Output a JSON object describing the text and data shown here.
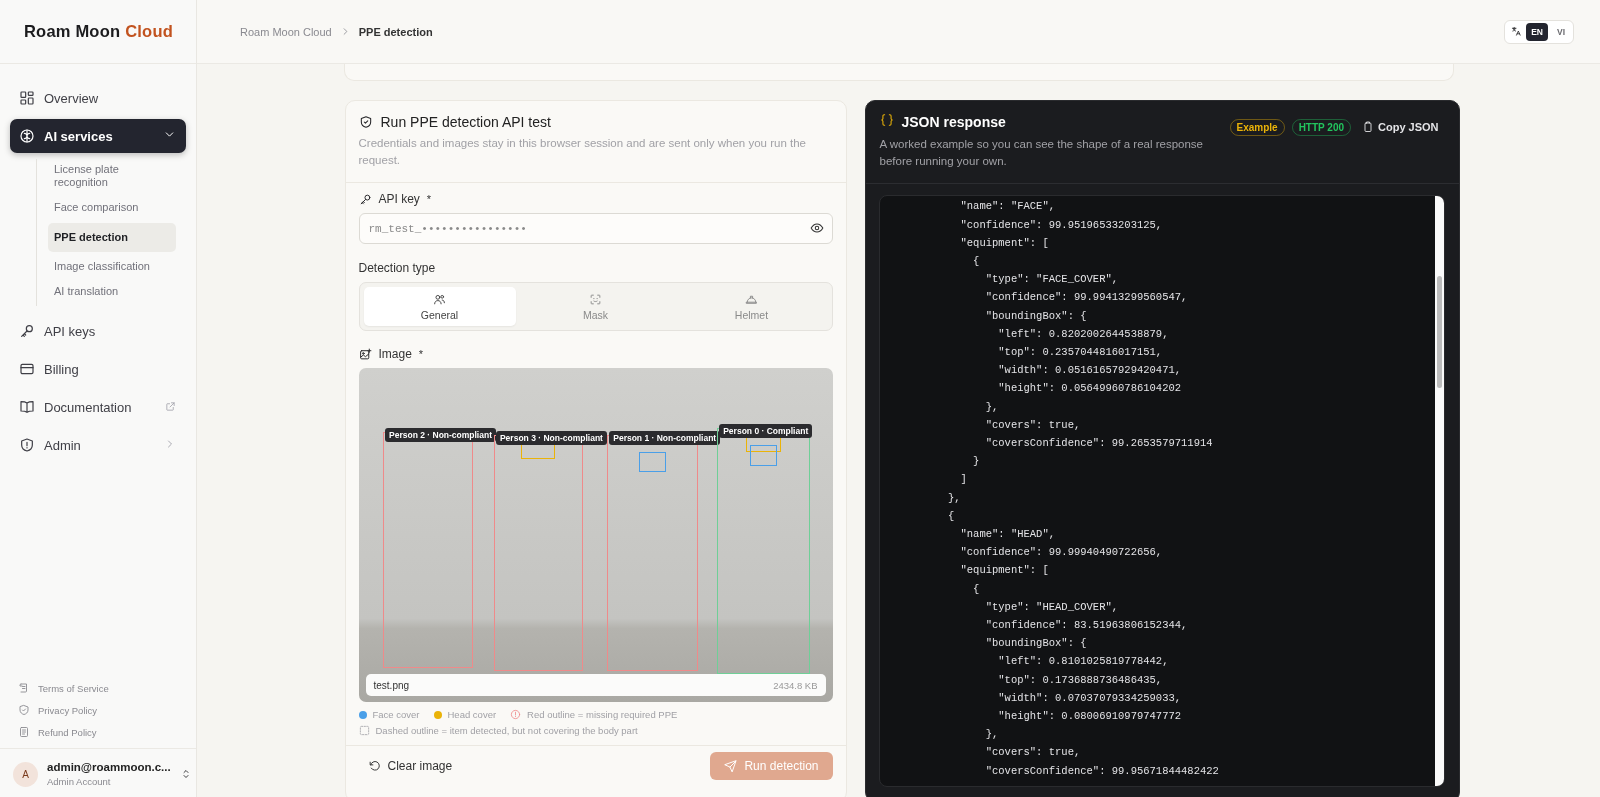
{
  "logo": {
    "text": "Roam Moon",
    "accent": "Cloud"
  },
  "breadcrumb": [
    "Roam Moon Cloud",
    "PPE detection"
  ],
  "languages": [
    {
      "label": "EN",
      "selected": true
    },
    {
      "label": "VI",
      "selected": false
    }
  ],
  "sidebar": {
    "items": [
      {
        "label": "Overview",
        "kind": "plain",
        "selected": false
      },
      {
        "label": "AI services",
        "kind": "group",
        "selected": true,
        "expanded": true,
        "children": [
          {
            "label": "License plate recognition",
            "selected": false
          },
          {
            "label": "Face comparison",
            "selected": false
          },
          {
            "label": "PPE detection",
            "selected": true
          },
          {
            "label": "Image classification",
            "selected": false
          },
          {
            "label": "AI translation",
            "selected": false
          }
        ]
      },
      {
        "label": "API keys",
        "kind": "plain",
        "selected": false
      },
      {
        "label": "Billing",
        "kind": "plain",
        "selected": false
      },
      {
        "label": "Documentation",
        "kind": "external",
        "selected": false
      },
      {
        "label": "Admin",
        "kind": "submenu",
        "selected": false
      }
    ],
    "footer_links": [
      "Terms of Service",
      "Privacy Policy",
      "Refund Policy"
    ],
    "user": {
      "avatar": "A",
      "email": "admin@roammoon.c...",
      "role": "Admin Account"
    }
  },
  "test_panel": {
    "title": "Run PPE detection API test",
    "description": "Credentials and images stay in this browser session and are sent only when you run the request.",
    "api_key": {
      "label": "API key",
      "required": "*",
      "value": "rm_test_••••••••••••••••"
    },
    "detection_type": {
      "label": "Detection type",
      "options": [
        {
          "label": "General",
          "selected": true
        },
        {
          "label": "Mask",
          "selected": false
        },
        {
          "label": "Helmet",
          "selected": false
        }
      ]
    },
    "image": {
      "label": "Image",
      "required": "*",
      "file_name": "test.png",
      "file_size": "2434.8 KB",
      "persons": [
        {
          "label": "Person 2 · Non-compliant",
          "compliant": false,
          "face_cover": false,
          "head_cover": false
        },
        {
          "label": "Person 3 · Non-compliant",
          "compliant": false,
          "face_cover": false,
          "head_cover": true
        },
        {
          "label": "Person 1 · Non-compliant",
          "compliant": false,
          "face_cover": true,
          "head_cover": false
        },
        {
          "label": "Person 0 · Compliant",
          "compliant": true,
          "face_cover": true,
          "head_cover": true
        }
      ]
    },
    "legend": [
      {
        "kind": "dot",
        "label": "Face cover",
        "color": "#4a9fe8"
      },
      {
        "kind": "dot",
        "label": "Head cover",
        "color": "#eab308"
      },
      {
        "kind": "outline",
        "label": "Red outline = missing required PPE"
      },
      {
        "kind": "dashed",
        "label": "Dashed outline = item detected, but not covering the body part"
      }
    ],
    "actions": [
      "Clear image",
      "Run detection"
    ]
  },
  "response_panel": {
    "title": "JSON response",
    "description": "A worked example so you can see the shape of a real response before running your own.",
    "badges": [
      {
        "label": "Example",
        "color": "#eab308"
      },
      {
        "label": "HTTP 200",
        "color": "#22c55e"
      }
    ],
    "copy_button": "Copy JSON",
    "code_lines": [
      "          \"name\": \"FACE\",",
      "          \"confidence\": 99.95196533203125,",
      "          \"equipment\": [",
      "            {",
      "              \"type\": \"FACE_COVER\",",
      "              \"confidence\": 99.99413299560547,",
      "              \"boundingBox\": {",
      "                \"left\": 0.8202002644538879,",
      "                \"top\": 0.2357044816017151,",
      "                \"width\": 0.05161657929420471,",
      "                \"height\": 0.05649960786104202",
      "              },",
      "              \"covers\": true,",
      "              \"coversConfidence\": 99.2653579711914",
      "            }",
      "          ]",
      "        },",
      "        {",
      "          \"name\": \"HEAD\",",
      "          \"confidence\": 99.99940490722656,",
      "          \"equipment\": [",
      "            {",
      "              \"type\": \"HEAD_COVER\",",
      "              \"confidence\": 83.51963806152344,",
      "              \"boundingBox\": {",
      "                \"left\": 0.8101025819778442,",
      "                \"top\": 0.1736888736486435,",
      "                \"width\": 0.07037079334259033,",
      "                \"height\": 0.08006910979747772",
      "              },",
      "              \"covers\": true,",
      "              \"coversConfidence\": 99.95671844482422"
    ]
  }
}
